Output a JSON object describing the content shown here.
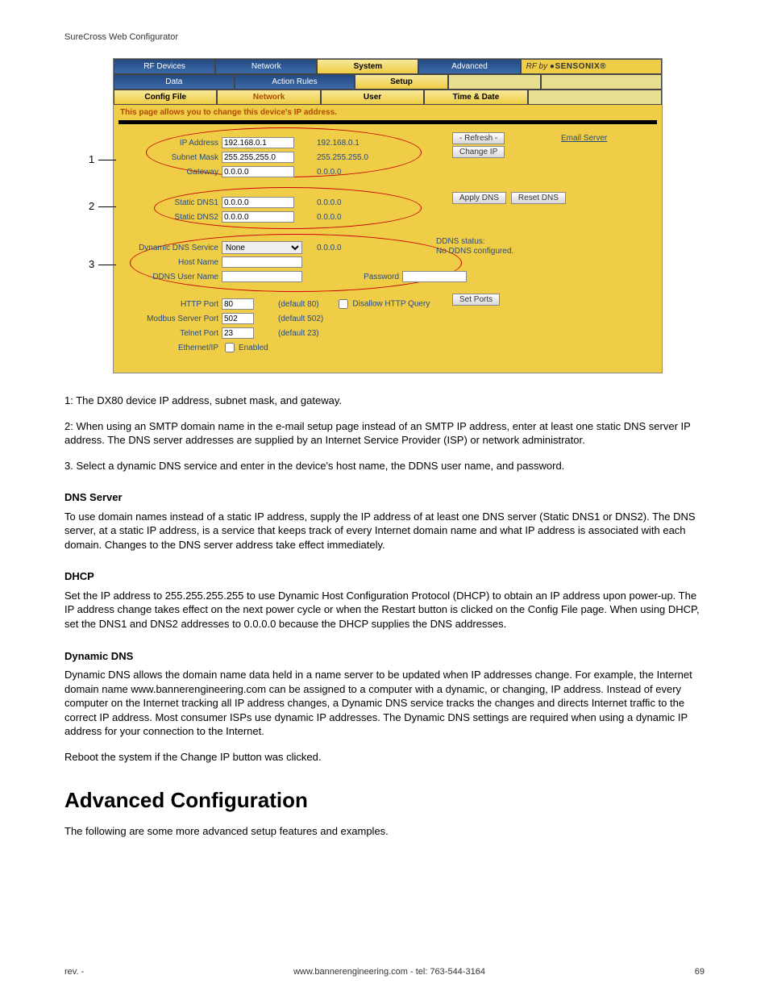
{
  "header": "SureCross Web Configurator",
  "callouts": {
    "c1": "1",
    "c2": "2",
    "c3": "3"
  },
  "tabs_top": [
    "RF Devices",
    "Network",
    "System",
    "Advanced"
  ],
  "brand_prefix": "RF by",
  "brand_name": "SENSONIX",
  "tabs_mid": [
    "Data",
    "Action Rules",
    "Setup"
  ],
  "tabs_low": [
    "Config File",
    "Network",
    "User",
    "Time & Date"
  ],
  "desc": "This page allows you to change this device's IP address.",
  "fields": {
    "ip_label": "IP Address",
    "ip_val": "192.168.0.1",
    "ip_out": "192.168.0.1",
    "mask_label": "Subnet Mask",
    "mask_val": "255.255.255.0",
    "mask_out": "255.255.255.0",
    "gw_label": "Gateway",
    "gw_val": "0.0.0.0",
    "gw_out": "0.0.0.0",
    "dns1_label": "Static DNS1",
    "dns1_val": "0.0.0.0",
    "dns1_out": "0.0.0.0",
    "dns2_label": "Static DNS2",
    "dns2_val": "0.0.0.0",
    "dns2_out": "0.0.0.0",
    "ddns_label": "Dynamic DNS Service",
    "ddns_val": "None",
    "ddns_out": "0.0.0.0",
    "host_label": "Host Name",
    "ddnsuser_label": "DDNS User Name",
    "pwd_label": "Password",
    "http_label": "HTTP Port",
    "http_val": "80",
    "http_def": "(default 80)",
    "modbus_label": "Modbus Server Port",
    "modbus_val": "502",
    "modbus_def": "(default 502)",
    "telnet_label": "Telnet Port",
    "telnet_val": "23",
    "telnet_def": "(default 23)",
    "eip_label": "Ethernet/IP",
    "eip_chk": "Enabled",
    "disallow": "Disallow HTTP Query"
  },
  "buttons": {
    "refresh": "- Refresh -",
    "changeip": "Change IP",
    "applydns": "Apply DNS",
    "resetdns": "Reset DNS",
    "setports": "Set Ports"
  },
  "links": {
    "email": "Email Server"
  },
  "ddns_status_label": "DDNS status:",
  "ddns_status_val": "No DDNS configured.",
  "notes": {
    "n1": "1: The DX80 device IP address, subnet mask, and gateway.",
    "n2": "2: When using an SMTP domain name in the e-mail setup page instead of an SMTP IP address, enter at least one static DNS server IP address. The DNS server addresses are supplied by an Internet Service Provider (ISP) or network administrator.",
    "n3": "3. Select a dynamic DNS service and enter in the device's host name, the DDNS user name, and password."
  },
  "sections": {
    "dns_h": "DNS Server",
    "dns_p": "To use domain names instead of a static IP address, supply the IP address of at least one DNS server (Static DNS1 or DNS2). The DNS server, at a static IP address, is a service that keeps track of every Internet domain name and what IP address is associated with each domain. Changes to the DNS server address take effect immediately.",
    "dhcp_h": "DHCP",
    "dhcp_p": "Set the IP address to 255.255.255.255 to use Dynamic Host Configuration Protocol (DHCP) to obtain an IP address upon power-up. The IP address change takes effect on the next power cycle or when the Restart button is clicked on the Config File page. When using DHCP, set the DNS1 and DNS2 addresses to 0.0.0.0 because the DHCP supplies the DNS addresses.",
    "ddns_h": "Dynamic DNS",
    "ddns_p": "Dynamic DNS allows the domain name data held in a name server to be updated when IP addresses change. For example, the Internet domain name www.bannerengineering.com can be assigned to a computer with a dynamic, or changing, IP address. Instead of every computer on the Internet tracking all IP address changes, a Dynamic DNS service tracks the changes and directs Internet traffic to the correct IP address. Most consumer ISPs use dynamic IP addresses. The Dynamic DNS settings are required when using a dynamic IP address for your connection to the Internet.",
    "reboot": "Reboot the system if the Change IP button was clicked."
  },
  "h2": "Advanced Configuration",
  "adv_p": "The following are some more advanced setup features and examples.",
  "footer": {
    "left": "rev. -",
    "center": "www.bannerengineering.com - tel: 763-544-3164",
    "right": "69"
  }
}
